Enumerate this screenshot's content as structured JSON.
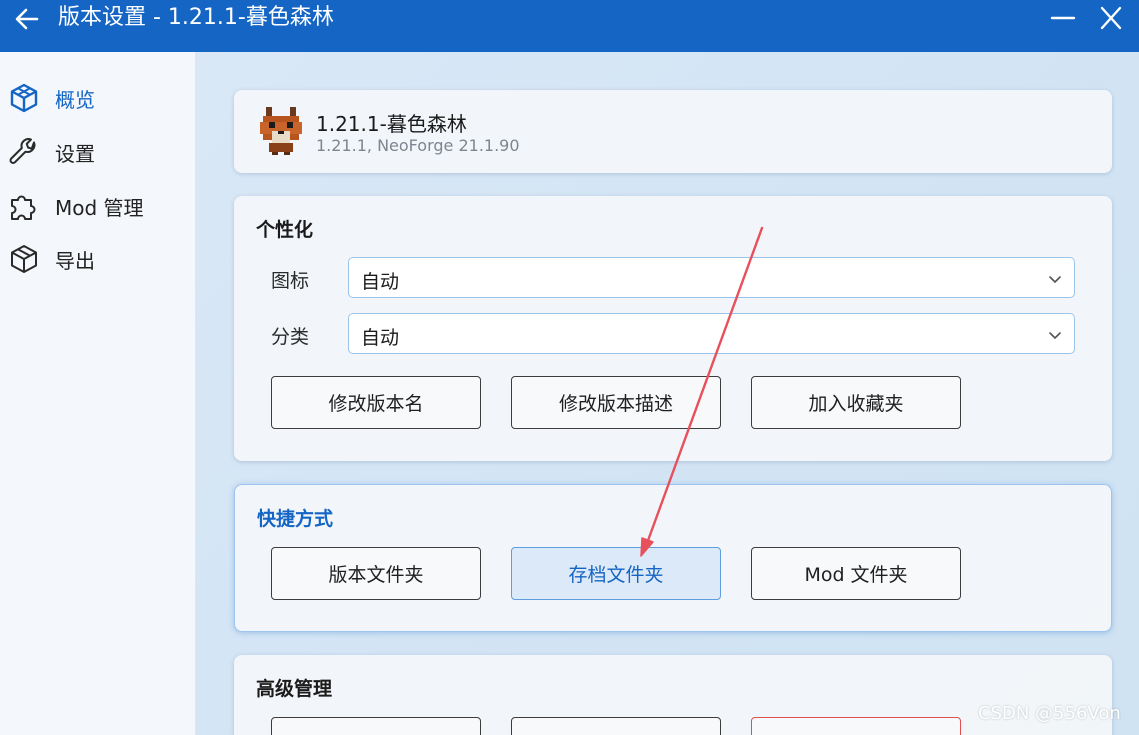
{
  "window": {
    "title": "版本设置 - 1.21.1-暮色森林",
    "back_icon": "arrow-left-icon",
    "minimize_icon": "minimize-icon",
    "close_icon": "close-icon",
    "titlebar_color": "#1565c4"
  },
  "sidebar": {
    "items": [
      {
        "label": "概览",
        "icon": "cube-icon",
        "active": true
      },
      {
        "label": "设置",
        "icon": "wrench-icon",
        "active": false
      },
      {
        "label": "Mod 管理",
        "icon": "puzzle-icon",
        "active": false
      },
      {
        "label": "导出",
        "icon": "box-icon",
        "active": false
      }
    ]
  },
  "instance": {
    "name": "1.21.1-暮色森林",
    "details": "1.21.1, NeoForge 21.1.90",
    "icon": "fox-pixel-icon"
  },
  "personalize": {
    "title": "个性化",
    "icon_label": "图标",
    "icon_value": "自动",
    "category_label": "分类",
    "category_value": "自动",
    "buttons": [
      "修改版本名",
      "修改版本描述",
      "加入收藏夹"
    ]
  },
  "shortcuts": {
    "title": "快捷方式",
    "buttons": [
      "版本文件夹",
      "存档文件夹",
      "Mod 文件夹"
    ]
  },
  "advanced": {
    "title": "高级管理"
  },
  "watermark": "CSDN @556Von",
  "accent_color": "#1565c4",
  "annotation_arrow_color": "#e8505b"
}
